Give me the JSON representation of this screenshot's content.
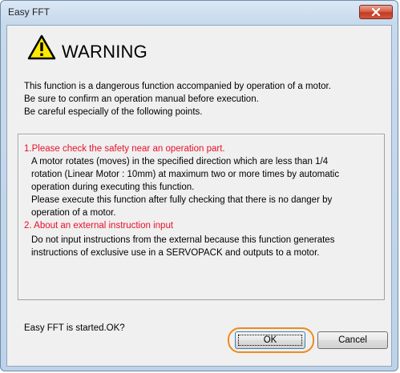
{
  "window": {
    "title": "Easy FFT"
  },
  "warning": {
    "title": "WARNING",
    "lines": [
      "This function is a dangerous function accompanied by operation of a motor.",
      "Be sure to confirm an operation manual before execution.",
      "Be careful especially of the following points."
    ]
  },
  "points": {
    "heading1": "1.Please check the safety near an operation part.",
    "p1_lines": [
      "A motor rotates (moves) in the specified direction which are less than 1/4",
      "rotation (Linear Motor : 10mm) at maximum two or more times by automatic",
      "operation during executing this function.",
      "Please execute this function after fully checking that there is no danger by",
      "operation of a motor."
    ],
    "heading2": "2. About an external instruction input",
    "p2_lines": [
      "Do not input instructions from the external because this function generates",
      "instructions of exclusive use in a SERVOPACK and outputs to a motor."
    ]
  },
  "confirm_text": "Easy FFT is started.OK?",
  "buttons": {
    "ok": "OK",
    "cancel": "Cancel"
  },
  "colors": {
    "warning_red": "#e8102a",
    "highlight_orange": "#ef8a1c",
    "warning_yellow": "#ffe800"
  }
}
